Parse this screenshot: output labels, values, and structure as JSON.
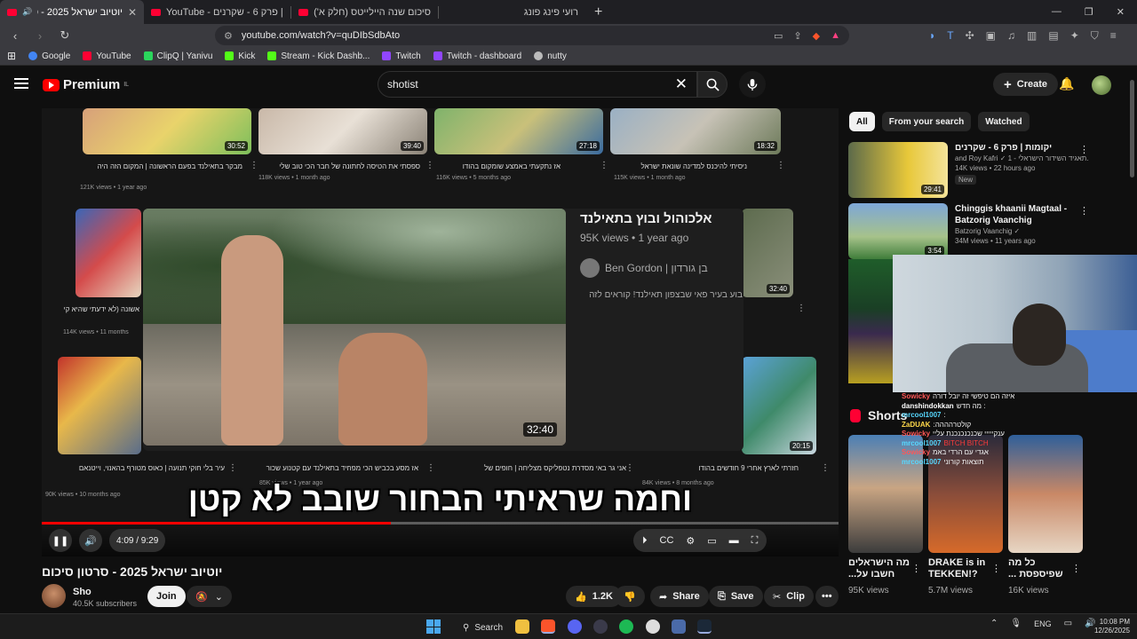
{
  "browser": {
    "tabs": [
      {
        "title": "יוטיוב ישראל 2025 - סרטון סי",
        "active": true
      },
      {
        "title": "YouTube - יקומות | פרק 6 - שקרנים",
        "active": false
      },
      {
        "title": "סיכום שנה היילייטס (חלק א') - YouTube",
        "active": false
      },
      {
        "title": "רועי פינג פונג",
        "active": false
      }
    ],
    "new_tab": "+",
    "url": "youtube.com/watch?v=quDIbSdbAto",
    "bookmarks": [
      {
        "label": "Google",
        "color": "#4285f4"
      },
      {
        "label": "YouTube",
        "color": "#ff0033"
      },
      {
        "label": "ClipQ | Yanivu",
        "color": "#2bd65c"
      },
      {
        "label": "Kick",
        "color": "#53fc18"
      },
      {
        "label": "Stream - Kick Dashb...",
        "color": "#53fc18"
      },
      {
        "label": "Twitch",
        "color": "#9146ff"
      },
      {
        "label": "Twitch - dashboard",
        "color": "#9146ff"
      },
      {
        "label": "nutty",
        "color": "#bbbbbb"
      }
    ]
  },
  "yt": {
    "logo_text": "Premium",
    "logo_sup": "IL",
    "search_value": "shotist",
    "create_label": "Create"
  },
  "player": {
    "grid_top": [
      {
        "time": "30:52",
        "title": "מבקר בתאילנד בפעם הראשונה | המקום הזה היה",
        "meta": "121K views • 1 year ago"
      },
      {
        "time": "39:40",
        "title": "ספסתי את הטיסה לחתונה של חבר הכי טוב שלי",
        "meta": "118K views • 1 month ago"
      },
      {
        "time": "27:18",
        "title": "אז נתקעתי באמצע שומקום בהודו",
        "meta": "116K views • 5 months ago"
      },
      {
        "time": "18:32",
        "title": "ניסיתי להיכנס למדינה שונאת ישראל",
        "meta": "115K views • 1 month ago"
      }
    ],
    "hover": {
      "title": "אלכוהול ובוץ בתאילנד",
      "meta": "95K views • 1 year ago",
      "channel": "Ben Gordon | בן גורדון",
      "desc": "בוע בעיר פאי שבצפון תאילנד! קוראים לזה",
      "time": "32:40"
    },
    "side_left": {
      "title": "אשונה (לא ידעתי שהיא קיימת)",
      "meta": "114K views • 11 months"
    },
    "side_right_time": "32:40",
    "side_right_time2": "20:15",
    "grid_bottom": [
      {
        "title": "עיר בלי חוקי תנועה | כאוס מטורף בהאנוי, וייטנאם",
        "meta": "90K views • 10 months ago"
      },
      {
        "title": "אז מסע בכביש הכי מפחיד בתאילנד עם קטנוע שכור",
        "meta": "85K views • 1 year ago"
      },
      {
        "title": "אני גר באי מסדרת נטפליקס מצליחה | חופים של",
        "meta": "85K views • 1 year ago"
      },
      {
        "title": "חזרתי לארץ אחרי 9 חודשים בהודו",
        "meta": "84K views • 8 months ago"
      }
    ],
    "subtitle": "וחמה שראיתי הבחור שובב לא קטן",
    "time_display": "4:09 / 9:29",
    "progress_fraction": 0.4376,
    "progress_color": "#ff0000"
  },
  "video": {
    "title": "יוטיוב ישראל 2025 - סרטון סיכום",
    "channel": "Sho",
    "subscribers": "40.5K subscribers",
    "join_label": "Join",
    "likes": "1.2K",
    "share_label": "Share",
    "save_label": "Save",
    "clip_label": "Clip"
  },
  "sidebar": {
    "chips": [
      "All",
      "From your search",
      "Watched"
    ],
    "recs": [
      {
        "title": "יקומות | פרק 6 - שקרנים",
        "channel": "and Roy Kafri ✓ תאגיד השידור הישראלי - 1...",
        "meta": "14K views • 22 hours ago",
        "badge": "New",
        "time": "29:41"
      },
      {
        "title": "Chinggis khaanii Magtaal - Batzorig Vaanchig",
        "channel": "Batzorig Vaanchig ✓",
        "meta": "34M views • 11 years ago",
        "time": "3:54"
      }
    ],
    "chat": [
      {
        "user": "Sowicky",
        "text": "איזה הם טיפשי זה יובל דורה",
        "color": "#ff5757"
      },
      {
        "user": "danshindokkan",
        "text": "מה חדש :",
        "color": "#ffffff"
      },
      {
        "user": "mrcool1007",
        "text": ":",
        "color": "#57d8ff"
      },
      {
        "user": "ZaDUAK",
        "text": ":קולטרהההה",
        "color": "#ffd84a"
      },
      {
        "user": "Sowicky",
        "text": "ענקייייי שכנכנכנכנת עליי",
        "color": "#ff5757"
      },
      {
        "user": "mrcool1007",
        "text": "BITCH BITCH",
        "color": "#57d8ff"
      },
      {
        "user": "Sowicky",
        "text": "אגדי עם הרדי באמ",
        "color": "#ff5757"
      },
      {
        "user": "mrcool1007",
        "text": "תוצאות קורוני",
        "color": "#57d8ff"
      }
    ],
    "shorts_label": "Shorts",
    "shorts": [
      {
        "title": "מה הישראלים חשבו על...",
        "views": "95K views"
      },
      {
        "title": "DRAKE is in TEKKEN!?",
        "views": "5.7M views"
      },
      {
        "title": "כל מה שפיספסת ...",
        "views": "16K views"
      }
    ]
  },
  "taskbar": {
    "search_label": "Search",
    "lang": "ENG",
    "time": "10:08 PM",
    "date": "12/26/2025"
  }
}
